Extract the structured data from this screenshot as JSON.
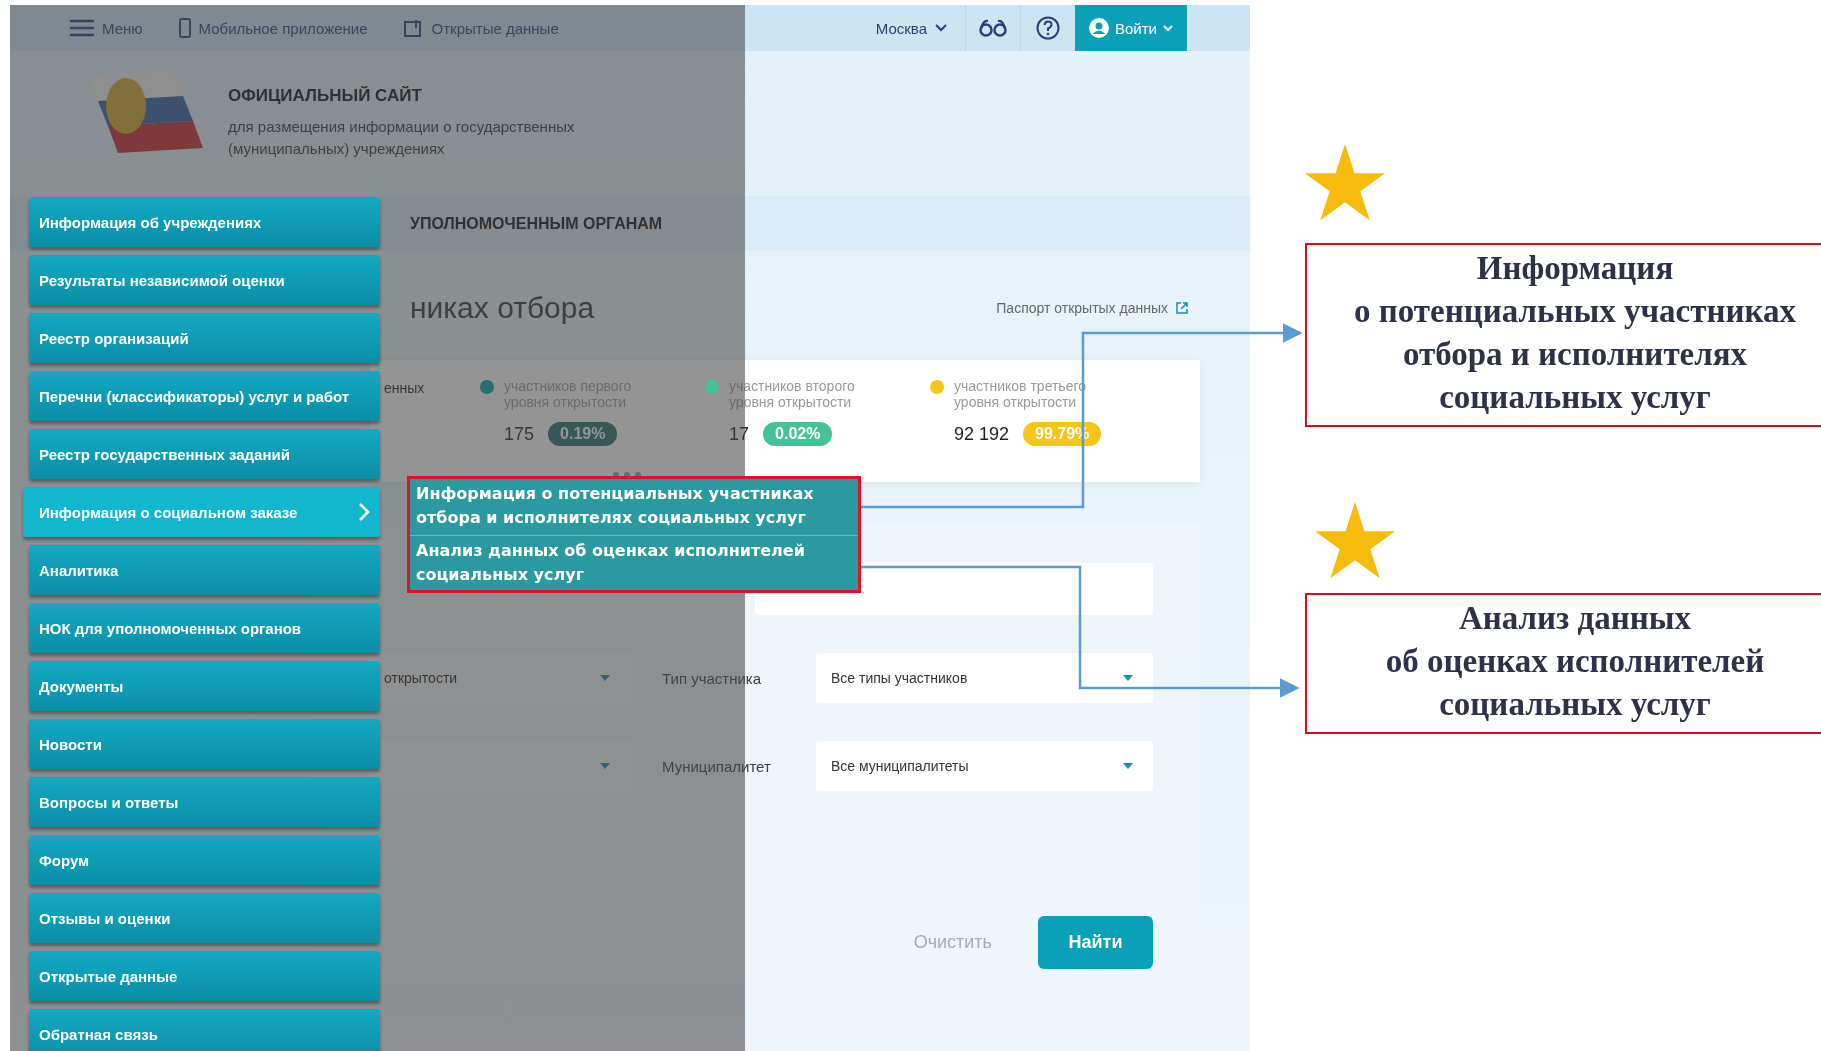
{
  "topbar": {
    "menu": "Меню",
    "mobile_app": "Мобильное приложение",
    "open_data": "Открытые данные",
    "city": "Москва",
    "login": "Войти"
  },
  "header": {
    "title": "ОФИЦИАЛЬНЫЙ САЙТ",
    "subtitle_lines": [
      "для размещения информации о государственных",
      "(муниципальных) учреждениях"
    ]
  },
  "nav_strip": {
    "label": "УПОЛНОМОЧЕННЫМ ОРГАНАМ"
  },
  "page_title": "никах отбора",
  "passport_link": "Паспорт открытых данных",
  "stats": {
    "partial_label": "енных",
    "items": [
      {
        "label_lines": [
          "участников первого",
          "уровня открытости"
        ],
        "count": "175",
        "percent": "0.19%",
        "color": "#23706f"
      },
      {
        "label_lines": [
          "участников второго",
          "уровня открытости"
        ],
        "count": "17",
        "percent": "0.02%",
        "color": "#45c29a"
      },
      {
        "label_lines": [
          "участников третьего",
          "уровня открытости"
        ],
        "count": "92 192",
        "percent": "99.79%",
        "color": "#f5c518"
      }
    ]
  },
  "filters": {
    "rows": [
      {
        "left_value": "открытости",
        "label": "Тип участника",
        "value": "Все типы участников"
      },
      {
        "left_value": "",
        "label": "Муниципалитет",
        "value": "Все муниципалитеты"
      }
    ]
  },
  "buttons": {
    "clear": "Очистить",
    "find": "Найти"
  },
  "menu": [
    {
      "label": "Информация об учреждениях",
      "selected": false
    },
    {
      "label": "Результаты независимой оценки",
      "selected": false
    },
    {
      "label": "Реестр организаций",
      "selected": false
    },
    {
      "label": "Перечни (классификаторы) услуг и работ",
      "selected": false
    },
    {
      "label": "Реестр государственных заданий",
      "selected": false
    },
    {
      "label": "Информация о социальном заказе",
      "selected": true
    },
    {
      "label": "Аналитика",
      "selected": false
    },
    {
      "label": "НОК для уполномоченных органов",
      "selected": false
    },
    {
      "label": "Документы",
      "selected": false
    },
    {
      "label": "Новости",
      "selected": false
    },
    {
      "label": "Вопросы и ответы",
      "selected": false
    },
    {
      "label": "Форум",
      "selected": false
    },
    {
      "label": "Отзывы и оценки",
      "selected": false
    },
    {
      "label": "Открытые данные",
      "selected": false
    },
    {
      "label": "Обратная связь",
      "selected": false
    }
  ],
  "submenu": [
    {
      "lines": [
        "Информация о потенциальных участниках",
        "отбора и исполнителях социальных услуг"
      ]
    },
    {
      "lines": [
        "Анализ данных об оценках исполнителей",
        "социальных услуг"
      ]
    }
  ],
  "callouts": [
    {
      "lines": [
        "Информация",
        "о потенциальных участниках",
        "отбора и исполнителях",
        "социальных услуг"
      ]
    },
    {
      "lines": [
        "Анализ данных",
        "об оценках исполнителей",
        "социальных услуг"
      ]
    }
  ]
}
